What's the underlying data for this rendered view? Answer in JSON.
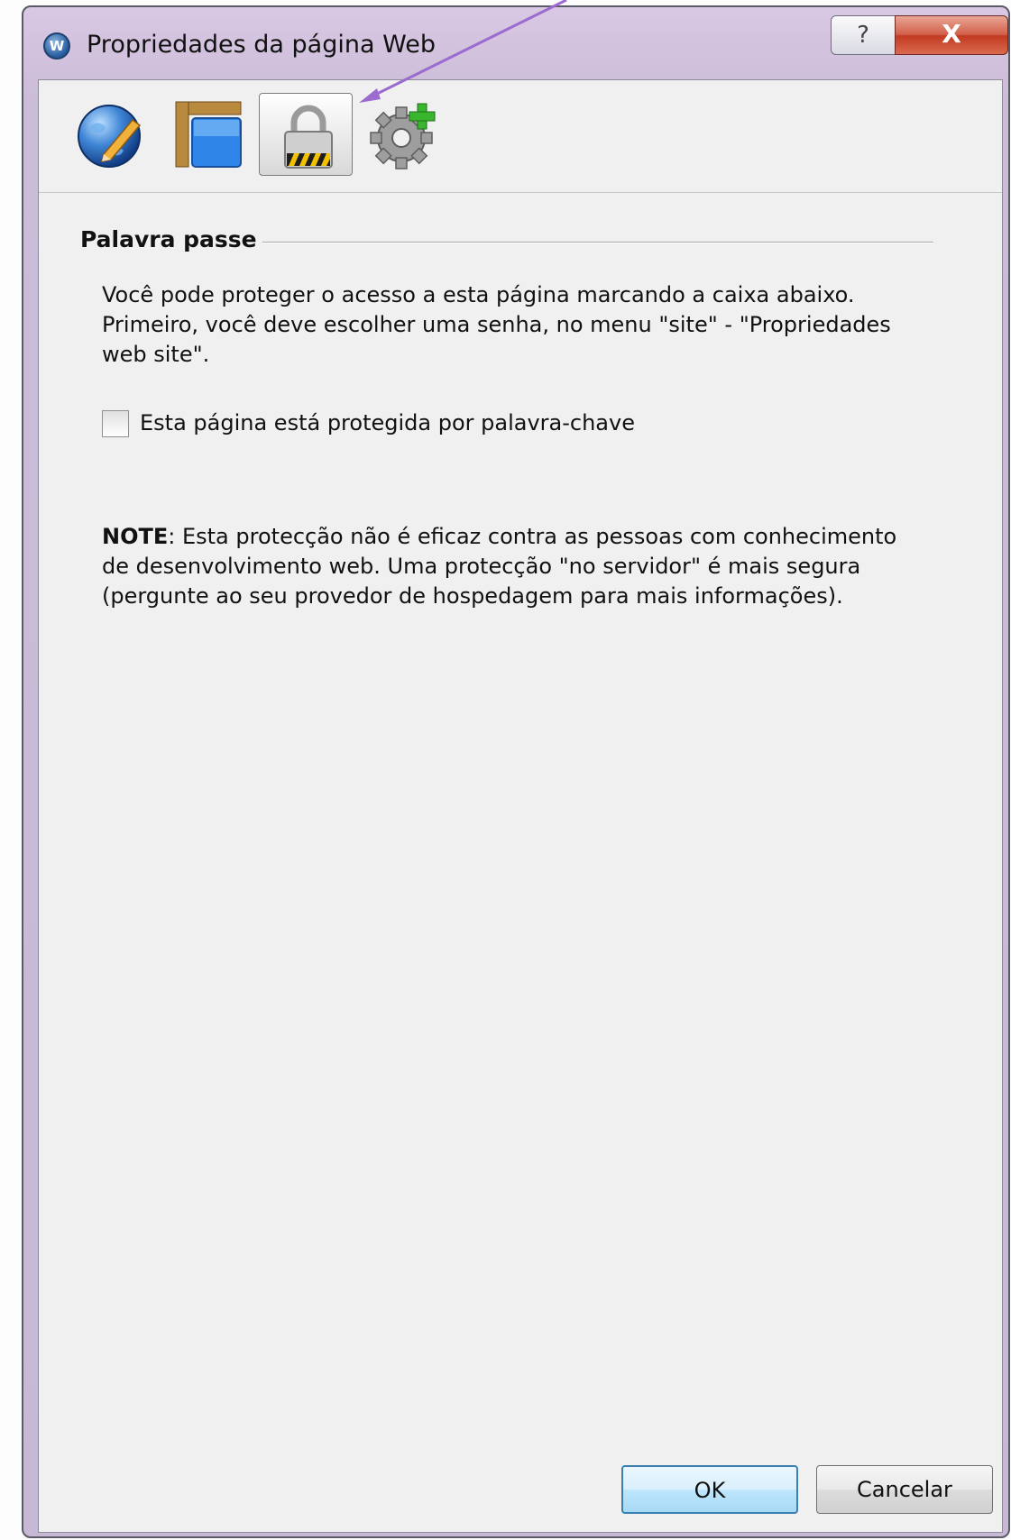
{
  "window": {
    "title": "Propriedades da página Web",
    "app_icon_letter": "W",
    "help_label": "?",
    "close_label": "X"
  },
  "toolbar": {
    "tabs": [
      {
        "icon": "globe-pencil-icon",
        "selected": false
      },
      {
        "icon": "page-layout-icon",
        "selected": false
      },
      {
        "icon": "padlock-icon",
        "selected": true
      },
      {
        "icon": "gear-plus-icon",
        "selected": false
      }
    ]
  },
  "section": {
    "title": "Palavra passe",
    "description": "Você pode proteger o acesso a esta página marcando a caixa abaixo. Primeiro, você deve escolher uma senha, no menu \"site\" - \"Propriedades web site\".",
    "checkbox_label": "Esta página está protegida por palavra-chave",
    "checkbox_checked": false,
    "note_label": "NOTE",
    "note_text": ": Esta protecção não é eficaz contra as pessoas com conhecimento de desenvolvimento web. Uma protecção \"no servidor\" é mais segura (pergunte ao seu provedor de hospedagem para mais informações)."
  },
  "buttons": {
    "ok_label": "OK",
    "cancel_label": "Cancelar"
  },
  "colors": {
    "titlebar": "#cbbcd8",
    "client_bg": "#f0f0f0",
    "close_button": "#c23a22",
    "default_button_border": "#3c7fb1",
    "annotation_arrow": "#9b6bcf"
  }
}
